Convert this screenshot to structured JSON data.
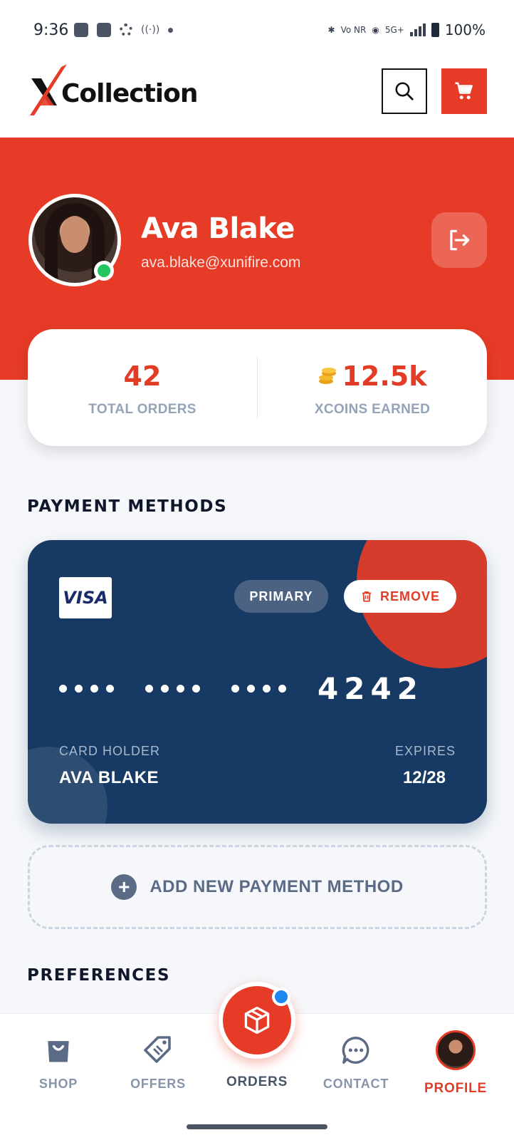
{
  "status_bar": {
    "time": "9:36",
    "signal_text": "5G+",
    "battery": "100%",
    "vonr": "Vo NR"
  },
  "header": {
    "logo": "XCollection",
    "search_icon": "search-icon",
    "cart_icon": "cart-icon"
  },
  "profile": {
    "name": "Ava Blake",
    "email": "ava.blake@xunifire.com",
    "online_status": "online"
  },
  "stats": {
    "orders_value": "42",
    "orders_label": "TOTAL ORDERS",
    "coins_value": "12.5k",
    "coins_label": "XCOINS EARNED"
  },
  "payment": {
    "section_title": "PAYMENT METHODS",
    "card": {
      "brand": "VISA",
      "primary_label": "PRIMARY",
      "remove_label": "REMOVE",
      "last4": "4242",
      "holder_label": "CARD HOLDER",
      "holder_name": "AVA BLAKE",
      "expires_label": "EXPIRES",
      "expires_value": "12/28"
    },
    "add_label": "ADD NEW PAYMENT METHOD"
  },
  "preferences": {
    "section_title": "PREFERENCES"
  },
  "bottom_nav": {
    "shop": "SHOP",
    "offers": "OFFERS",
    "orders": "ORDERS",
    "contact": "CONTACT",
    "profile": "PROFILE",
    "active": "PROFILE"
  },
  "colors": {
    "brand_red": "#e63b26",
    "card_navy": "#163a63",
    "online_green": "#22c55e",
    "badge_blue": "#1e88f0"
  }
}
